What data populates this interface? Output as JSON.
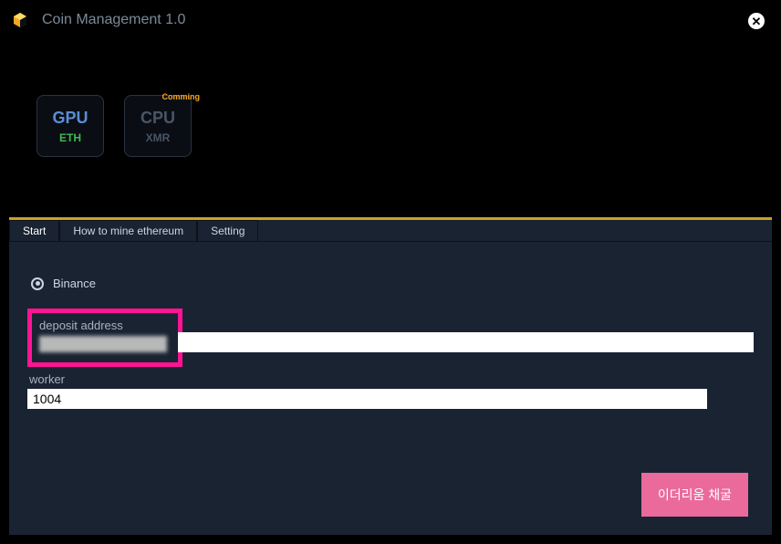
{
  "titlebar": {
    "title": "Coin Management 1.0"
  },
  "miners": {
    "gpu": {
      "type": "GPU",
      "coin": "ETH"
    },
    "cpu": {
      "type": "CPU",
      "coin": "XMR",
      "badge": "Comming"
    }
  },
  "tabs": {
    "start": "Start",
    "howto": "How to mine ethereum",
    "setting": "Setting"
  },
  "form": {
    "exchange_label": "Binance",
    "deposit_label": "deposit address",
    "deposit_value": "",
    "worker_label": "worker",
    "worker_value": "1004"
  },
  "actions": {
    "mine_label": "이더리움 채굴"
  }
}
